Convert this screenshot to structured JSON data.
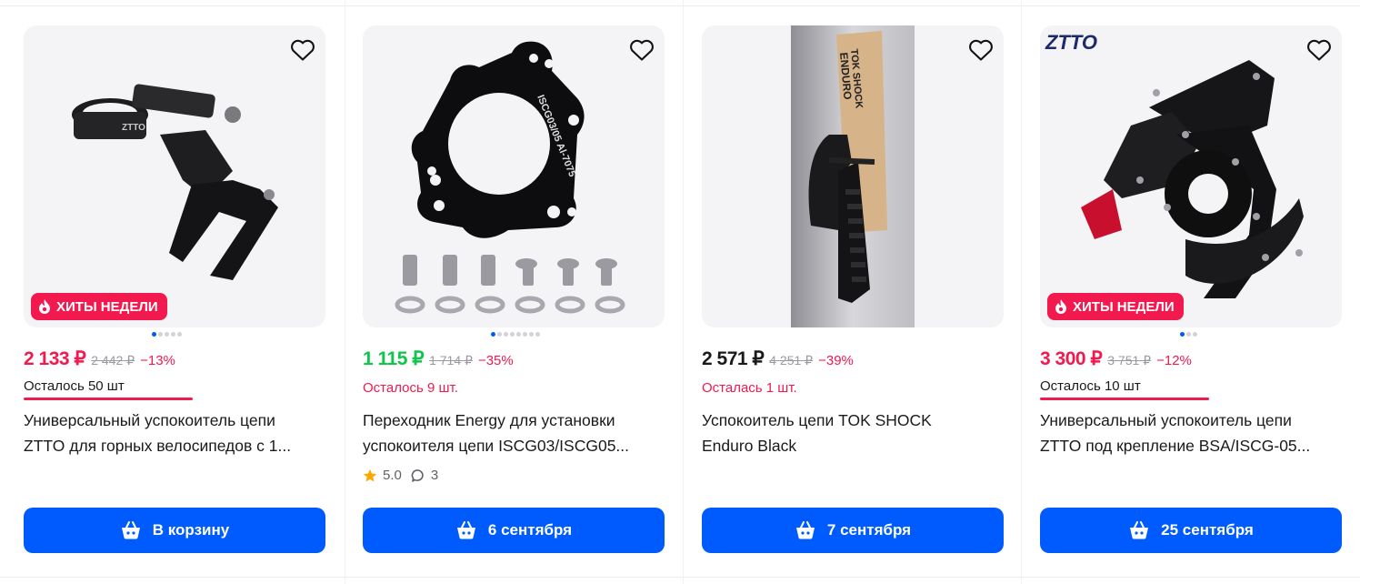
{
  "colors": {
    "brand_blue": "#005bff",
    "sale_red": "#f2194e",
    "green_price": "#10c44c",
    "image_bg": "#f4f4f6"
  },
  "products": [
    {
      "image_icon": "chain-guide-clamp-image",
      "badge": "ХИТЫ НЕДЕЛИ",
      "price_now": "2 133 ₽",
      "price_now_color": "#f2194e",
      "price_old": "2 442 ₽",
      "discount": "−13%",
      "stock": "Осталось 50 шт",
      "stock_color": "#1a1a1a",
      "title_line1": "Универсальный успокоитель цепи",
      "title_line2": "ZTTO для горных велосипедов с 1...",
      "button": "В корзину"
    },
    {
      "image_icon": "iscg-adapter-image",
      "image_text": "ISCG03/05 Al-7075",
      "price_now": "1 115 ₽",
      "price_now_color": "#10c44c",
      "price_old": "1 714 ₽",
      "discount": "−35%",
      "stock": "Осталось 9 шт.",
      "stock_color": "#f2194e",
      "title_line1": "Переходник Energy для установки",
      "title_line2": "успокоителя цепи ISCG03/ISCG05...",
      "rating": "5.0",
      "reviews": "3",
      "button": "6 сентября"
    },
    {
      "image_icon": "tok-shock-package-image",
      "image_text_1": "ENDURO",
      "image_text_2": "TOK SHOCK",
      "price_now": "2 571 ₽",
      "price_now_color": "#1a1a1a",
      "price_old": "4 251 ₽",
      "discount": "−39%",
      "stock": "Осталась 1 шт.",
      "stock_color": "#f2194e",
      "title_line1": "Успокоитель цепи TOK SHOCK",
      "title_line2": "Enduro Black",
      "button": "7 сентября"
    },
    {
      "image_icon": "chain-guide-bsa-image",
      "image_brand": "ZTTO",
      "badge": "ХИТЫ НЕДЕЛИ",
      "price_now": "3 300 ₽",
      "price_now_color": "#f2194e",
      "price_old": "3 751 ₽",
      "discount": "−12%",
      "stock": "Осталось 10 шт",
      "stock_color": "#1a1a1a",
      "title_line1": "Универсальный успокоитель цепи",
      "title_line2": "ZTTO под крепление BSA/ISCG-05...",
      "button": "25 сентября"
    }
  ]
}
